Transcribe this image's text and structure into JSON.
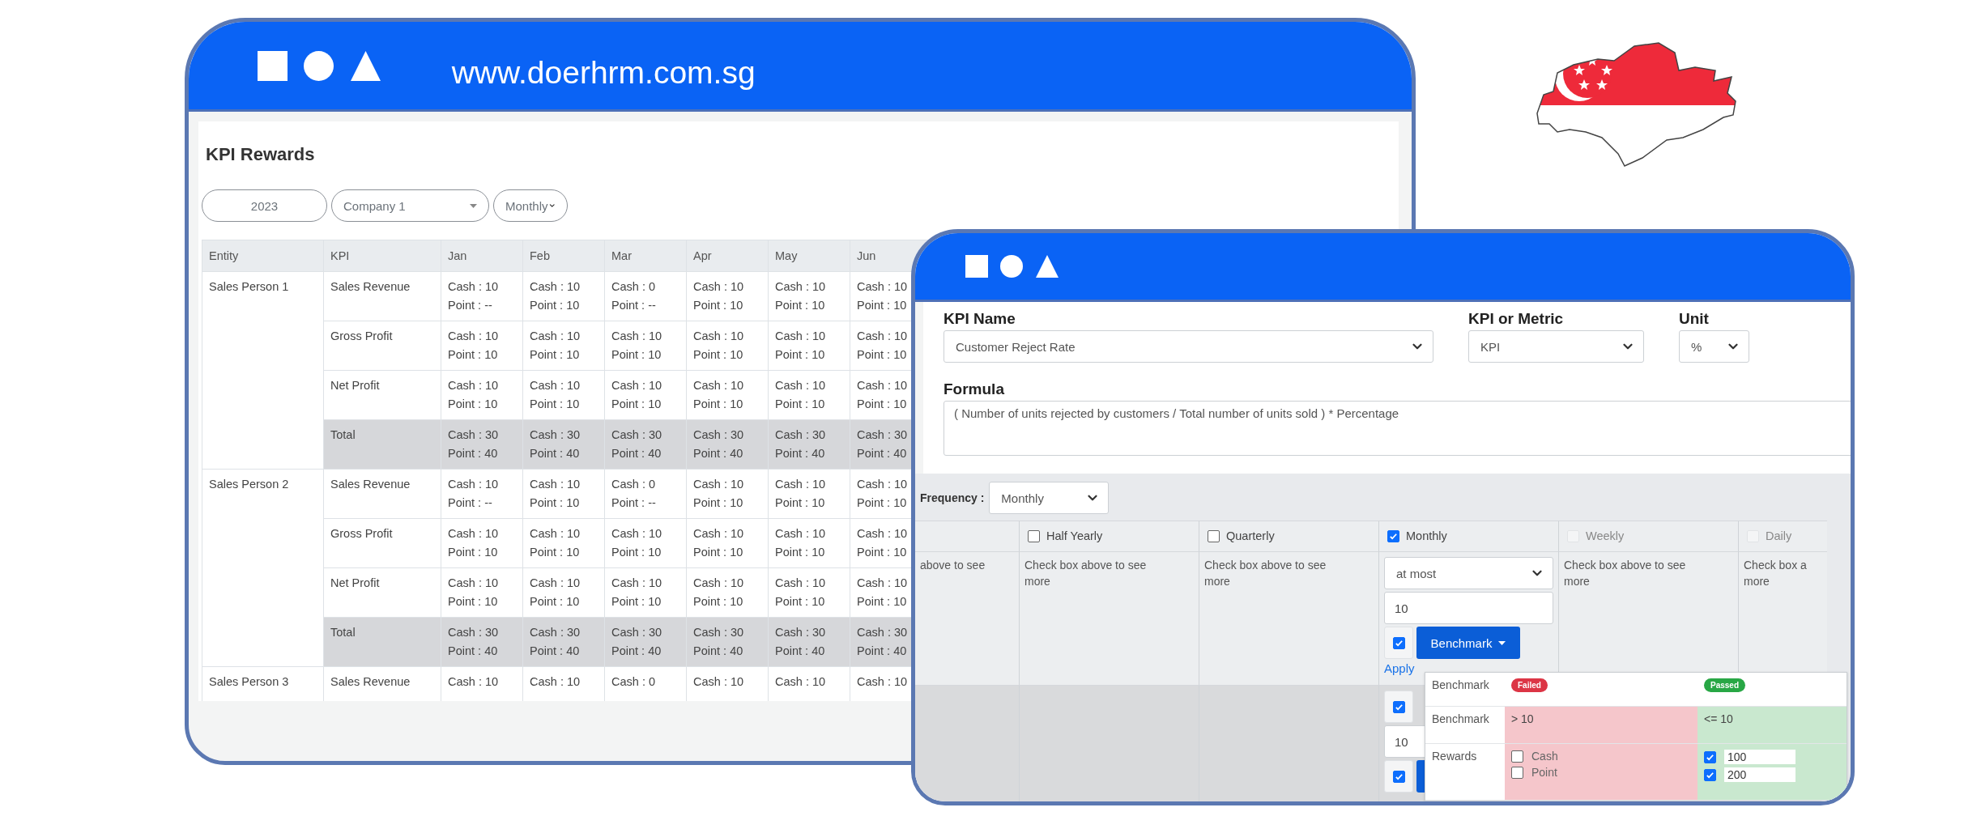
{
  "back_window": {
    "url": "www.doerhrm.com.sg",
    "title": "KPI Rewards",
    "filters": {
      "year": "2023",
      "company": "Company 1",
      "period": "Monthly"
    },
    "table": {
      "columns": [
        "Entity",
        "KPI",
        "Jan",
        "Feb",
        "Mar",
        "Apr",
        "May",
        "Jun"
      ],
      "groups": [
        {
          "entity": "Sales Person 1",
          "rows": [
            {
              "kind": "kpi",
              "kpi": "Sales Revenue",
              "cells": [
                [
                  "Cash : 10",
                  "Point : --"
                ],
                [
                  "Cash : 10",
                  "Point : 10"
                ],
                [
                  "Cash : 0",
                  "Point : --"
                ],
                [
                  "Cash : 10",
                  "Point : 10"
                ],
                [
                  "Cash : 10",
                  "Point : 10"
                ],
                [
                  "Cash : 10",
                  "Point : 10"
                ]
              ]
            },
            {
              "kind": "kpi",
              "kpi": "Gross Profit",
              "cells": [
                [
                  "Cash : 10",
                  "Point : 10"
                ],
                [
                  "Cash : 10",
                  "Point : 10"
                ],
                [
                  "Cash : 10",
                  "Point : 10"
                ],
                [
                  "Cash : 10",
                  "Point : 10"
                ],
                [
                  "Cash : 10",
                  "Point : 10"
                ],
                [
                  "Cash : 10",
                  "Point : 10"
                ]
              ]
            },
            {
              "kind": "kpi",
              "kpi": "Net Profit",
              "cells": [
                [
                  "Cash : 10",
                  "Point : 10"
                ],
                [
                  "Cash : 10",
                  "Point : 10"
                ],
                [
                  "Cash : 10",
                  "Point : 10"
                ],
                [
                  "Cash : 10",
                  "Point : 10"
                ],
                [
                  "Cash : 10",
                  "Point : 10"
                ],
                [
                  "Cash : 10",
                  "Point : 10"
                ]
              ]
            },
            {
              "kind": "total",
              "kpi": "Total",
              "cells": [
                [
                  "Cash : 30",
                  "Point : 40"
                ],
                [
                  "Cash : 30",
                  "Point : 40"
                ],
                [
                  "Cash : 30",
                  "Point : 40"
                ],
                [
                  "Cash : 30",
                  "Point : 40"
                ],
                [
                  "Cash : 30",
                  "Point : 40"
                ],
                [
                  "Cash : 30",
                  "Point : 40"
                ]
              ]
            }
          ]
        },
        {
          "entity": "Sales Person 2",
          "rows": [
            {
              "kind": "kpi",
              "kpi": "Sales Revenue",
              "cells": [
                [
                  "Cash : 10",
                  "Point : --"
                ],
                [
                  "Cash : 10",
                  "Point : 10"
                ],
                [
                  "Cash : 0",
                  "Point : --"
                ],
                [
                  "Cash : 10",
                  "Point : 10"
                ],
                [
                  "Cash : 10",
                  "Point : 10"
                ],
                [
                  "Cash : 10",
                  "Point : 10"
                ]
              ]
            },
            {
              "kind": "kpi",
              "kpi": "Gross Profit",
              "cells": [
                [
                  "Cash : 10",
                  "Point : 10"
                ],
                [
                  "Cash : 10",
                  "Point : 10"
                ],
                [
                  "Cash : 10",
                  "Point : 10"
                ],
                [
                  "Cash : 10",
                  "Point : 10"
                ],
                [
                  "Cash : 10",
                  "Point : 10"
                ],
                [
                  "Cash : 10",
                  "Point : 10"
                ]
              ]
            },
            {
              "kind": "kpi",
              "kpi": "Net Profit",
              "cells": [
                [
                  "Cash : 10",
                  "Point : 10"
                ],
                [
                  "Cash : 10",
                  "Point : 10"
                ],
                [
                  "Cash : 10",
                  "Point : 10"
                ],
                [
                  "Cash : 10",
                  "Point : 10"
                ],
                [
                  "Cash : 10",
                  "Point : 10"
                ],
                [
                  "Cash : 10",
                  "Point : 10"
                ]
              ]
            },
            {
              "kind": "total",
              "kpi": "Total",
              "cells": [
                [
                  "Cash : 30",
                  "Point : 40"
                ],
                [
                  "Cash : 30",
                  "Point : 40"
                ],
                [
                  "Cash : 30",
                  "Point : 40"
                ],
                [
                  "Cash : 30",
                  "Point : 40"
                ],
                [
                  "Cash : 30",
                  "Point : 40"
                ],
                [
                  "Cash : 30",
                  "Point : 40"
                ]
              ]
            }
          ]
        },
        {
          "entity": "Sales Person 3",
          "rows": [
            {
              "kind": "kpi",
              "kpi": "Sales Revenue",
              "cells": [
                [
                  "Cash : 10"
                ],
                [
                  "Cash : 10"
                ],
                [
                  "Cash : 0"
                ],
                [
                  "Cash : 10"
                ],
                [
                  "Cash : 10"
                ],
                [
                  "Cash : 10"
                ]
              ]
            }
          ]
        }
      ]
    }
  },
  "front_window": {
    "fields": [
      {
        "label": "KPI Name",
        "value": "Customer Reject Rate"
      },
      {
        "label": "KPI or Metric",
        "value": "KPI"
      },
      {
        "label": "Unit",
        "value": "%"
      }
    ],
    "formula": {
      "label": "Formula",
      "value": "( Number of units rejected by customers / Total number of units sold ) * Percentage"
    },
    "frequency": {
      "label": "Frequency :",
      "value": "Monthly"
    },
    "periods": [
      {
        "kind": "cut",
        "hint": [
          "above to see"
        ]
      },
      {
        "kind": "period",
        "label": "Half Yearly",
        "checked": false,
        "disabled": false,
        "hint": [
          "Check box above to see",
          "more"
        ]
      },
      {
        "kind": "period",
        "label": "Quarterly",
        "checked": false,
        "disabled": false,
        "hint": [
          "Check box above to see",
          "more"
        ]
      },
      {
        "kind": "period",
        "label": "Monthly",
        "checked": true,
        "disabled": false
      },
      {
        "kind": "period",
        "label": "Weekly",
        "checked": false,
        "disabled": true,
        "hint": [
          "Check box above to see",
          "more"
        ]
      },
      {
        "kind": "period",
        "label": "Daily",
        "checked": false,
        "disabled": true,
        "hint": [
          "Check box a",
          "more"
        ]
      }
    ],
    "monthly": {
      "condition": "at most",
      "value": "10",
      "enabled": true,
      "button": "Benchmark",
      "link": "Apply",
      "popup": {
        "header_label": "Benchmark",
        "failed_badge": "Failed",
        "passed_badge": "Passed",
        "benchmark_label": "Benchmark",
        "failed_benchmark": "> 10",
        "passed_benchmark": "<= 10",
        "rewards_label": "Rewards",
        "failed_rewards": [
          {
            "label": "Cash",
            "checked": false
          },
          {
            "label": "Point",
            "checked": false
          }
        ],
        "passed_rewards": [
          {
            "value": "100",
            "checked": true
          },
          {
            "value": "200",
            "checked": true
          }
        ]
      },
      "next_row": {
        "enabled": true,
        "value": "10",
        "benchmark_enabled": true
      }
    }
  }
}
